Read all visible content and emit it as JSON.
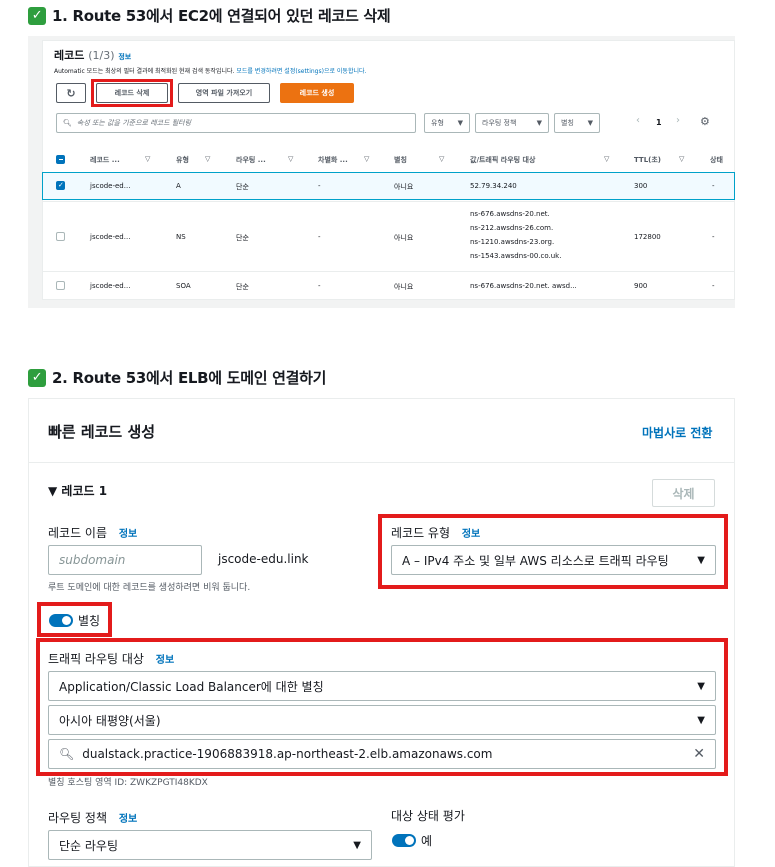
{
  "section1": {
    "heading": "1. Route 53에서 EC2에 연결되어 있던 레코드 삭제",
    "title": "레코드",
    "count": "(1/3)",
    "info": "정보",
    "subtitle_pre": "Automatic 모드는 최상의 필터 결과에 최적화된 현재 검색 동작입니다. ",
    "subtitle_link": "모드를 변경하려면 설정(settings)으로 이동합니다.",
    "buttons": {
      "delete": "레코드 삭제",
      "import": "영역 파일 가져오기",
      "create": "레코드 생성"
    },
    "filter_placeholder": "속성 또는 값을 기준으로 레코드 필터링",
    "dropdowns": [
      "유형",
      "라우팅 정책",
      "별칭"
    ],
    "page": "1",
    "columns": [
      "레코드 ...",
      "유형",
      "라우팅 ...",
      "차별화 ...",
      "별칭",
      "값/트래픽 라우팅 대상",
      "TTL(초)",
      "상태"
    ],
    "rows": [
      {
        "name": "jscode-ed...",
        "type": "A",
        "routing": "단순",
        "diff": "-",
        "alias": "아니요",
        "values": [
          "52.79.34.240"
        ],
        "ttl": "300",
        "status": "-"
      },
      {
        "name": "jscode-ed...",
        "type": "NS",
        "routing": "단순",
        "diff": "-",
        "alias": "아니요",
        "values": [
          "ns-676.awsdns-20.net.",
          "ns-212.awsdns-26.com.",
          "ns-1210.awsdns-23.org.",
          "ns-1543.awsdns-00.co.uk."
        ],
        "ttl": "172800",
        "status": "-"
      },
      {
        "name": "jscode-ed...",
        "type": "SOA",
        "routing": "단순",
        "diff": "-",
        "alias": "아니요",
        "values": [
          "ns-676.awsdns-20.net. awsd..."
        ],
        "ttl": "900",
        "status": "-"
      }
    ]
  },
  "section2": {
    "heading": "2. Route 53에서 ELB에 도메인 연결하기",
    "title": "빠른 레코드 생성",
    "wizard_link": "마법사로 전환",
    "record_header": "▼ 레코드 1",
    "delete_button": "삭제",
    "record_name_label": "레코드 이름",
    "info": "정보",
    "record_name_placeholder": "subdomain",
    "domain_suffix": "jscode-edu.link",
    "record_name_hint": "루트 도메인에 대한 레코드를 생성하려면 비워 둡니다.",
    "record_type_label": "레코드 유형",
    "record_type_value": "A – IPv4 주소 및 일부 AWS 리소스로 트래픽 라우팅",
    "alias_label": "별칭",
    "traffic_label": "트래픽 라우팅 대상",
    "endpoint_value": "Application/Classic Load Balancer에 대한 별칭",
    "region_value": "아시아 태평양(서울)",
    "lb_value": "dualstack.practice-1906883918.ap-northeast-2.elb.amazonaws.com",
    "hosted_zone_text": "별칭 호스팅 영역 ID: ZWKZPGTI48KDX",
    "routing_policy_label": "라우팅 정책",
    "routing_policy_value": "단순 라우팅",
    "health_label": "대상 상태 평가",
    "health_value": "예"
  },
  "colors": {
    "accent": "#0073bb",
    "orange": "#ec7211",
    "highlight": "#e31b1b",
    "check": "#2e9e3e"
  }
}
